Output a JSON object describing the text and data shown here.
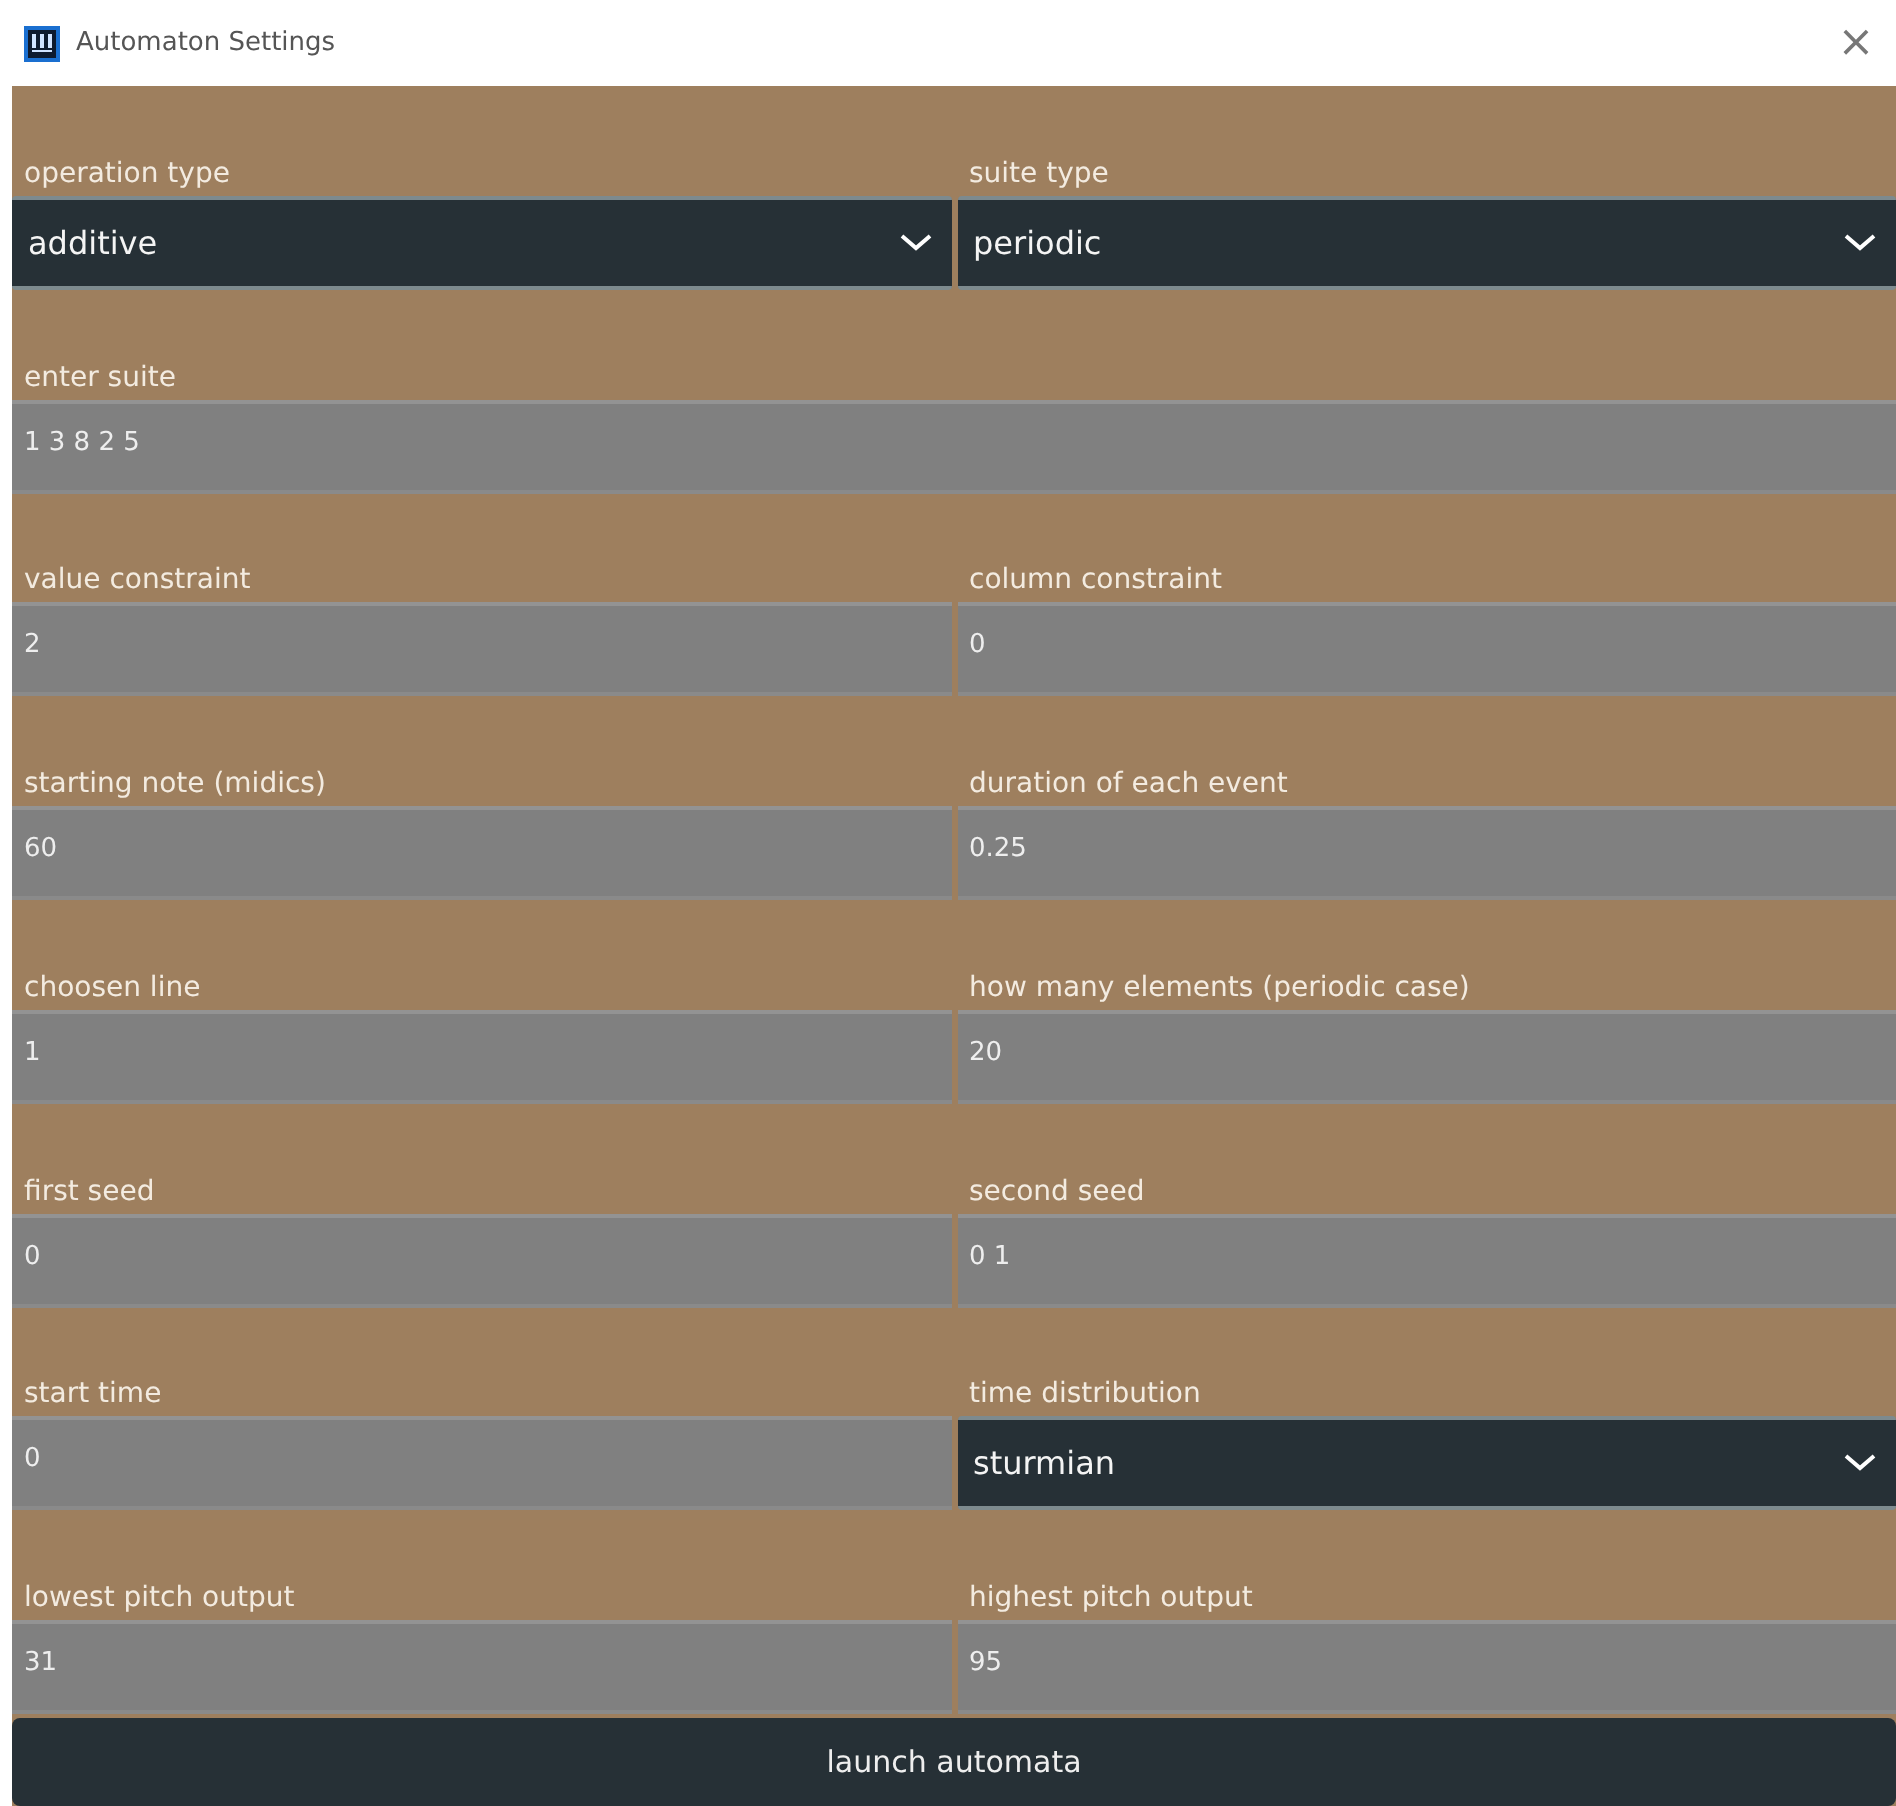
{
  "window": {
    "title": "Automaton Settings",
    "close": "×"
  },
  "rows": [
    {
      "fields": [
        {
          "label": "operation type",
          "kind": "dropdown",
          "value": "additive"
        },
        {
          "label": "suite type",
          "kind": "dropdown",
          "value": "periodic"
        }
      ]
    },
    {
      "fields": [
        {
          "label": "enter suite",
          "kind": "text",
          "value": "1 3 8 2 5"
        }
      ]
    },
    {
      "fields": [
        {
          "label": "value constraint",
          "kind": "text",
          "value": "2"
        },
        {
          "label": "column constraint",
          "kind": "text",
          "value": "0"
        }
      ]
    },
    {
      "fields": [
        {
          "label": "starting note (midics)",
          "kind": "text",
          "value": "60"
        },
        {
          "label": "duration of each event",
          "kind": "text",
          "value": "0.25"
        }
      ]
    },
    {
      "fields": [
        {
          "label": "choosen line",
          "kind": "text",
          "value": "1"
        },
        {
          "label": "how many elements (periodic case)",
          "kind": "text",
          "value": "20"
        }
      ]
    },
    {
      "fields": [
        {
          "label": "first seed",
          "kind": "text",
          "value": "0"
        },
        {
          "label": "second seed",
          "kind": "text",
          "value": "0 1"
        }
      ]
    },
    {
      "fields": [
        {
          "label": "start time",
          "kind": "text",
          "value": "0"
        },
        {
          "label": "time distribution",
          "kind": "dropdown",
          "value": "sturmian"
        }
      ]
    },
    {
      "fields": [
        {
          "label": "lowest pitch output",
          "kind": "text",
          "value": "31"
        },
        {
          "label": "highest pitch output",
          "kind": "text",
          "value": "95"
        }
      ]
    }
  ],
  "button": "launch automata"
}
